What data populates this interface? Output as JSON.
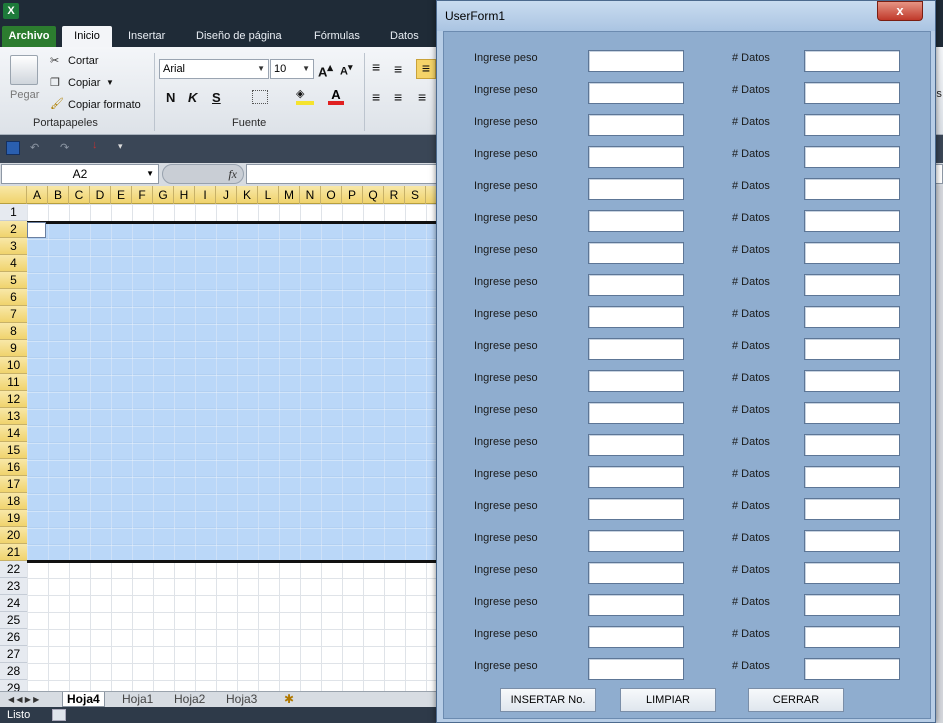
{
  "excel": {
    "logo": "X",
    "ribbon_tabs": [
      "Archivo",
      "Inicio",
      "Insertar",
      "Diseño de página",
      "Fórmulas",
      "Datos"
    ],
    "clipboard": {
      "paste": "Pegar",
      "cut": "Cortar",
      "copy": "Copiar",
      "format_painter": "Copiar formato",
      "group_label": "Portapapeles"
    },
    "font": {
      "name": "Arial",
      "size": "10",
      "group_label": "Fuente",
      "bold": "N",
      "italic": "K",
      "underline": "S"
    },
    "name_box": "A2",
    "fx": "fx",
    "columns": [
      "A",
      "B",
      "C",
      "D",
      "E",
      "F",
      "G",
      "H",
      "I",
      "J",
      "K",
      "L",
      "M",
      "N",
      "O",
      "P",
      "Q",
      "R",
      "S"
    ],
    "rows": [
      "1",
      "2",
      "3",
      "4",
      "5",
      "6",
      "7",
      "8",
      "9",
      "10",
      "11",
      "12",
      "13",
      "14",
      "15",
      "16",
      "17",
      "18",
      "19",
      "20",
      "21",
      "22",
      "23",
      "24",
      "25",
      "26",
      "27",
      "28",
      "29"
    ],
    "sheets": [
      "Hoja4",
      "Hoja1",
      "Hoja2",
      "Hoja3"
    ],
    "status": "Listo",
    "right_edge_text": "Es"
  },
  "userform": {
    "title": "UserForm1",
    "close": "x",
    "row_label_left": "Ingrese peso",
    "row_label_right": "# Datos",
    "row_count": 20,
    "buttons": {
      "insert": "INSERTAR No.",
      "clear": "LIMPIAR",
      "close": "CERRAR"
    }
  }
}
